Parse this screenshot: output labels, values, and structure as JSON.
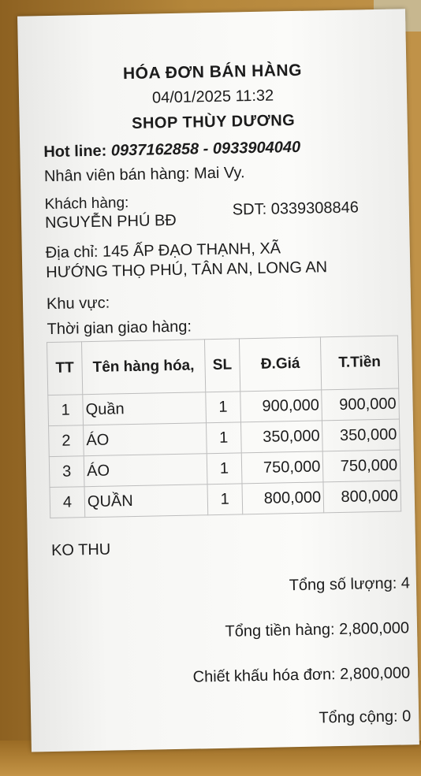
{
  "receipt": {
    "title": "HÓA ĐƠN BÁN HÀNG",
    "datetime": "04/01/2025 11:32",
    "shop_name": "SHOP THÙY DƯƠNG",
    "hotline_label": "Hot line:",
    "hotline_numbers": "0937162858 - 0933904040",
    "staff": "Nhân viên bán hàng: Mai Vy.",
    "customer_label": "Khách hàng:",
    "customer_name": "NGUYỄN PHÚ BĐ",
    "phone": "SDT: 0339308846",
    "address_line1": "Địa chỉ: 145 ẤP ĐẠO THẠNH, XÃ",
    "address_line2": "HƯỚNG THỌ PHÚ, TÂN AN, LONG AN",
    "area": "Khu vực:",
    "delivery_time": "Thời gian giao hàng:",
    "table": {
      "headers": {
        "tt": "TT",
        "name": "Tên hàng hóa,",
        "qty": "SL",
        "unit_price": "Đ.Giá",
        "total": "T.Tiền"
      },
      "rows": [
        {
          "tt": "1",
          "name": "Quần",
          "qty": "1",
          "unit_price": "900,000",
          "total": "900,000"
        },
        {
          "tt": "2",
          "name": "ÁO",
          "qty": "1",
          "unit_price": "350,000",
          "total": "350,000"
        },
        {
          "tt": "3",
          "name": "ÁO",
          "qty": "1",
          "unit_price": "750,000",
          "total": "750,000"
        },
        {
          "tt": "4",
          "name": "QUẦN",
          "qty": "1",
          "unit_price": "800,000",
          "total": "800,000"
        }
      ]
    },
    "note": "KO THU",
    "total_quantity": "Tổng số lượng: 4",
    "total_goods": "Tổng tiền hàng: 2,800,000",
    "invoice_discount": "Chiết khấu hóa đơn: 2,800,000",
    "grand_total": "Tổng cộng: 0"
  }
}
